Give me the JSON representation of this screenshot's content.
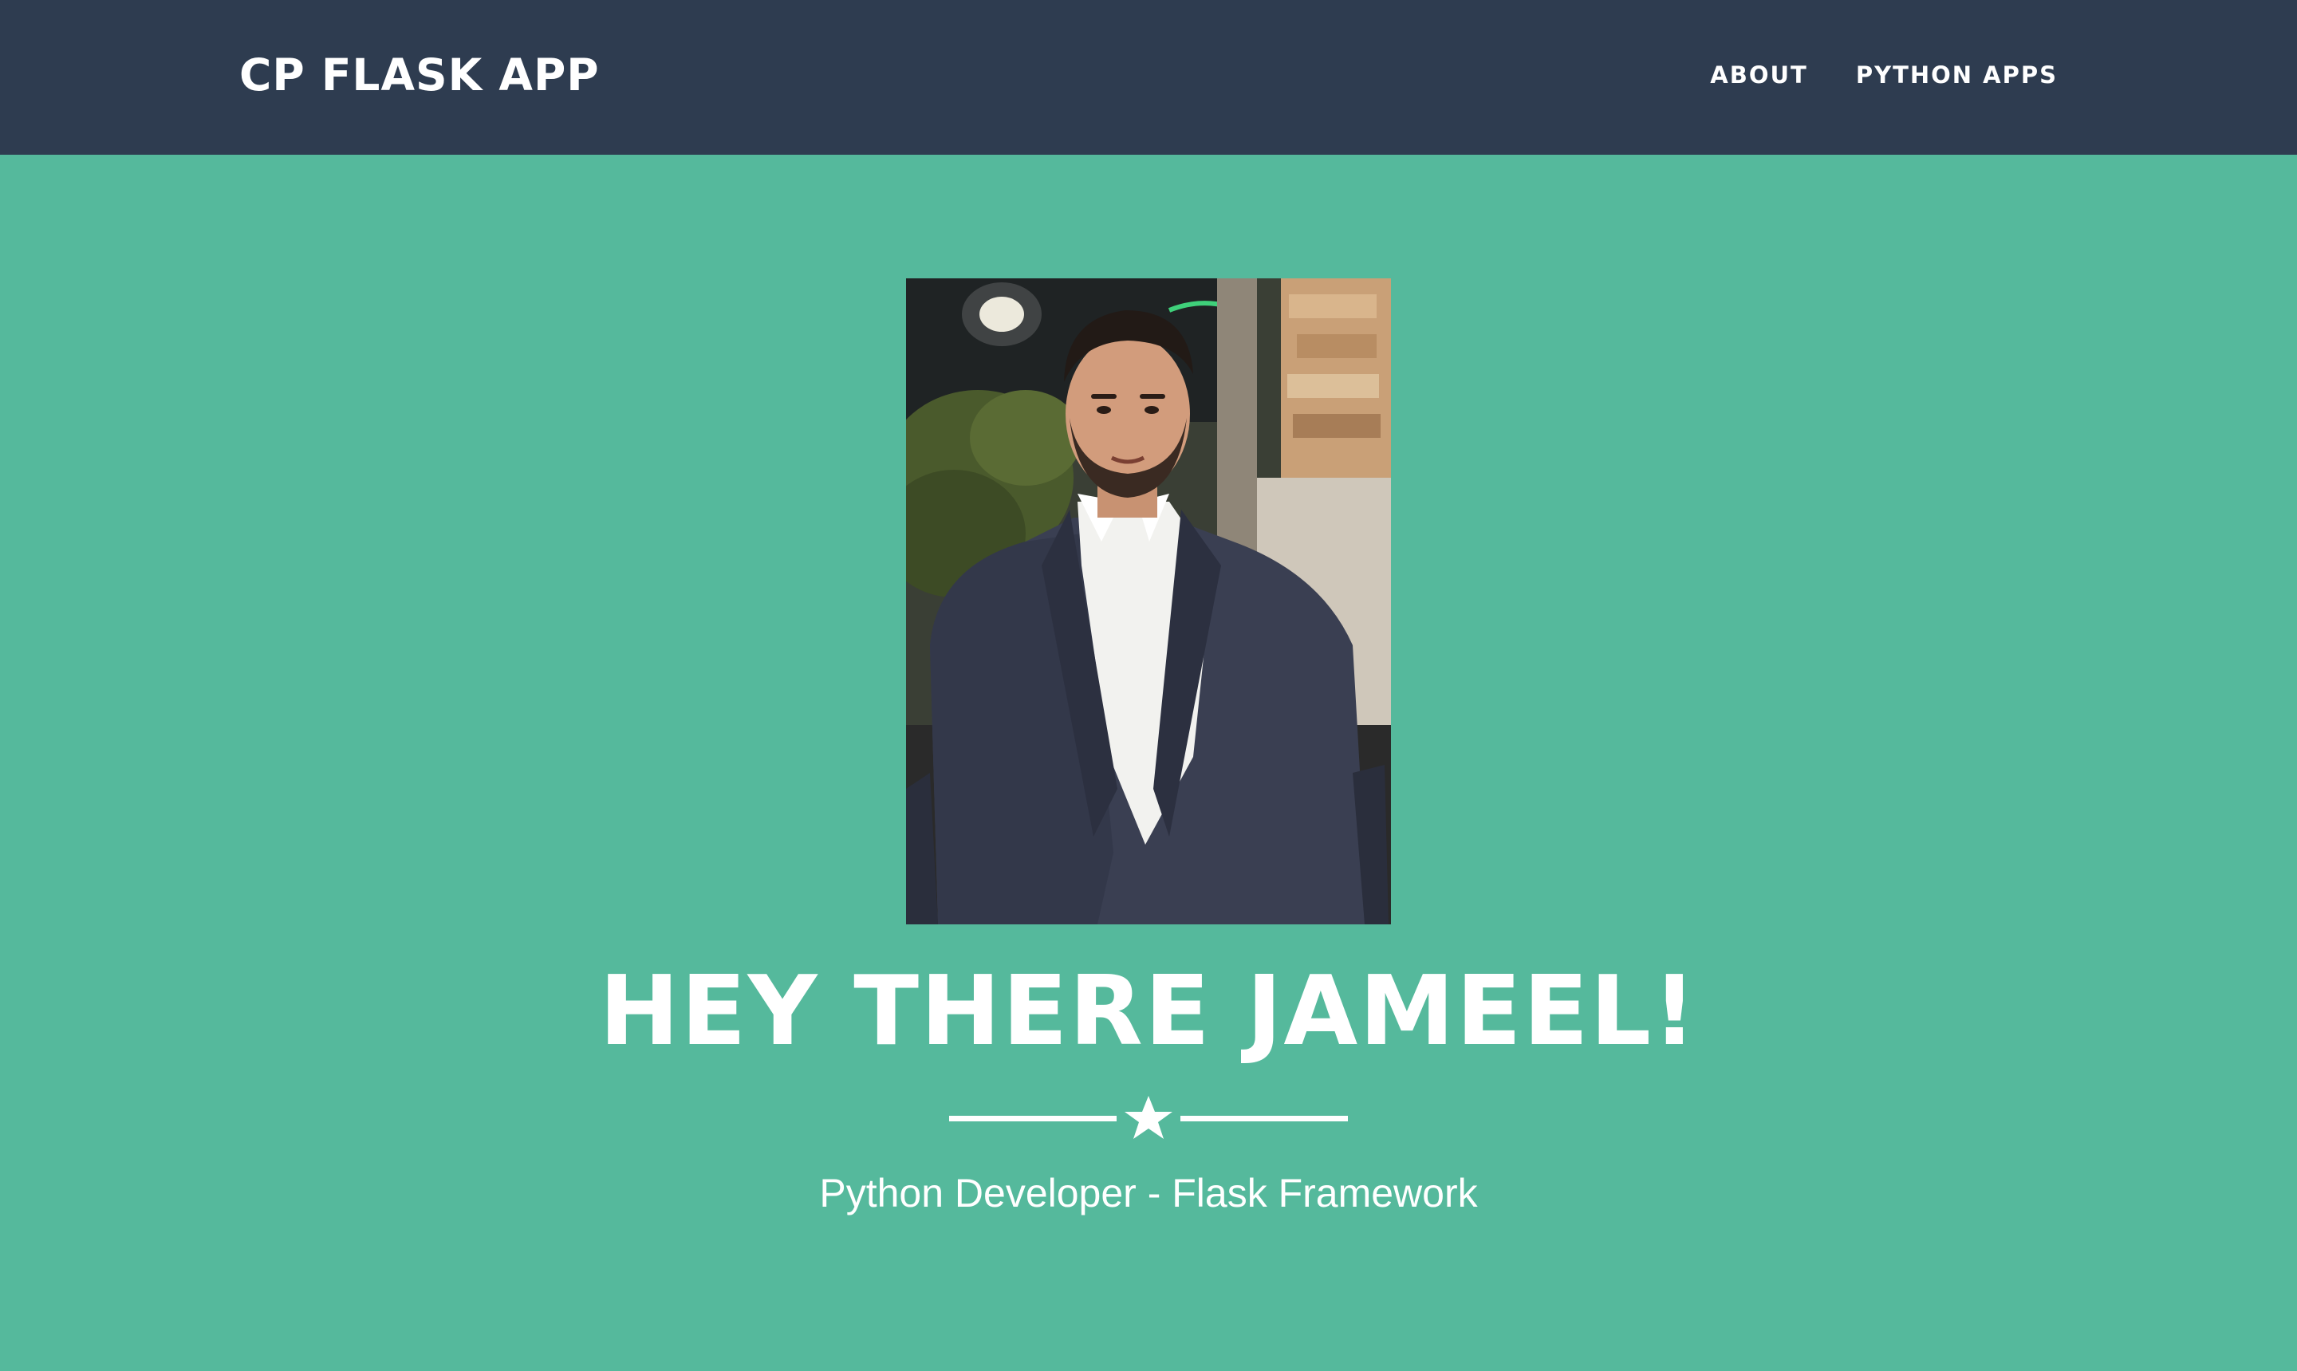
{
  "navbar": {
    "brand": "CP FLASK APP",
    "links": [
      {
        "label": "ABOUT"
      },
      {
        "label": "PYTHON APPS"
      }
    ]
  },
  "hero": {
    "photo_alt": "Profile photo",
    "title": "HEY THERE JAMEEL!",
    "divider_icon": "star-icon",
    "subtitle": "Python Developer - Flask Framework"
  },
  "colors": {
    "navbar_bg": "#2e3c50",
    "hero_bg": "#55b99c",
    "text": "#ffffff"
  }
}
